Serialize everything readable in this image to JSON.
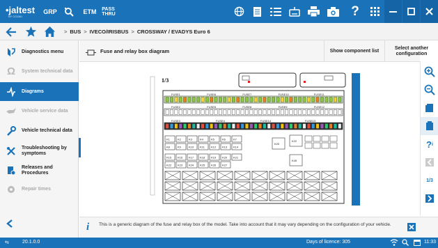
{
  "topbar": {
    "logo_main": "•jaltest",
    "logo_sub": "BY COJALI",
    "grp_label": "GRP",
    "etm_label": "ETM",
    "passthru_line1": "PASS",
    "passthru_line2": "THRU",
    "icons": [
      "search-tool-icon",
      "globe-icon",
      "document-icon",
      "list-icon",
      "keyboard-icon",
      "printer-icon",
      "camera-icon",
      "help-icon",
      "apps-grid-icon",
      "minimize-icon",
      "maximize-icon",
      "close-icon"
    ]
  },
  "nav": {
    "breadcrumb": [
      "BUS",
      "IVECO/IRISBUS",
      "CROSSWAY / EVADYS Euro 6"
    ]
  },
  "sidebar": {
    "items": [
      {
        "label": "Diagnostics menu",
        "icon": "diagnostics-icon",
        "state": "normal"
      },
      {
        "label": "System technical data",
        "icon": "omega-icon",
        "state": "disabled"
      },
      {
        "label": "Diagrams",
        "icon": "diagram-icon",
        "state": "active"
      },
      {
        "label": "Vehicle service data",
        "icon": "oil-can-icon",
        "state": "disabled"
      },
      {
        "label": "Vehicle technical data",
        "icon": "wrench-icon",
        "state": "normal"
      },
      {
        "label": "Troubleshooting by symptoms",
        "icon": "tools-icon",
        "state": "normal"
      },
      {
        "label": "Releases and Procedures",
        "icon": "procedures-icon",
        "state": "normal"
      },
      {
        "label": "Repair times",
        "icon": "repair-gear-icon",
        "state": "disabled"
      }
    ]
  },
  "content": {
    "title": "Fuse and relay box diagram",
    "show_component_list": "Show component list",
    "select_configuration_line1": "Select another",
    "select_configuration_line2": "configuration"
  },
  "diagram": {
    "page_label": "1/3",
    "fuse_row1": [
      "FUSE1",
      "FUSE6",
      "FUSE7",
      "FUSE10",
      "FUSE11"
    ],
    "fuse_row2": [
      "FUSE2",
      "FUSE5",
      "FUSE8",
      "FUSE9",
      "FUSE12"
    ],
    "fuse_row3": [
      "FUSE3",
      "FUSE4",
      "FUSE14",
      "FUSE13"
    ],
    "relays_row1": [
      "K1",
      "K2",
      "K3",
      "K4",
      "K5",
      "K6",
      "K7",
      "K8",
      "K9",
      "K10",
      "K11",
      "K12",
      "K13",
      "K14"
    ],
    "relays_row2": [
      "K15",
      "K16",
      "K17",
      "K18",
      "K19",
      "K20",
      "K21",
      "K22",
      "K23",
      "K24",
      "K25",
      "K26",
      "K27"
    ],
    "relays_misc": [
      "K20",
      "K22",
      "K45"
    ],
    "side_tab": "Jaltest"
  },
  "right_tools": {
    "page_indicator": "1/3"
  },
  "info": {
    "text": "This is a generic diagram of the fuse and relay box of the model. Take into account that it may vary depending on the configuration of your vehicle."
  },
  "status": {
    "version": "20.1.0.0",
    "licence": "Days of licence: 305",
    "time": "11:33"
  },
  "colors": {
    "brand_blue": "#1a73b8",
    "fuse_green": "#8dc63f",
    "fuse_dark": "#222222"
  }
}
